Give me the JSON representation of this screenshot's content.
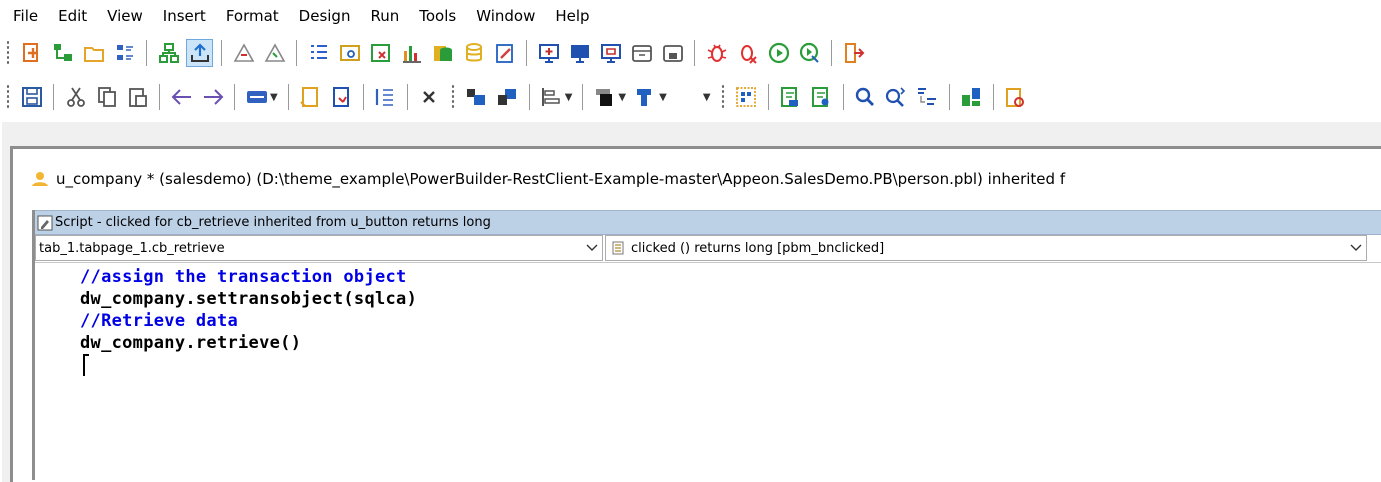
{
  "menu": [
    "File",
    "Edit",
    "View",
    "Insert",
    "Format",
    "Design",
    "Run",
    "Tools",
    "Window",
    "Help"
  ],
  "toolbar1": {
    "buttons": [
      {
        "name": "new-icon",
        "color": "#e07020"
      },
      {
        "name": "inherit-icon",
        "color": "#2a9d3a"
      },
      {
        "name": "open-folder-icon",
        "color": "#e5a52a"
      },
      {
        "name": "library-icon",
        "color": "#3060c0"
      },
      {
        "name": "system-tree-icon",
        "color": "#2a9d3a"
      },
      {
        "name": "output-up-icon",
        "color": "#1f6fd0",
        "active": true
      },
      {
        "name": "build-icon",
        "color": "#888888"
      },
      {
        "name": "deploy-icon",
        "color": "#888888"
      },
      {
        "name": "list-icon",
        "color": "#2a60d0"
      },
      {
        "name": "browser-icon",
        "color": "#d0a020"
      },
      {
        "name": "clip-window-icon",
        "color": "#d03030"
      },
      {
        "name": "chart-icon",
        "color": "#e09020"
      },
      {
        "name": "database-icon",
        "color": "#2a9d3a"
      },
      {
        "name": "db-profile-icon",
        "color": "#e0b020"
      },
      {
        "name": "edit-source-icon",
        "color": "#d04040"
      },
      {
        "name": "run-window-icon",
        "color": "#c03030"
      },
      {
        "name": "monitor-icon",
        "color": "#2050b0"
      },
      {
        "name": "debug-window-icon",
        "color": "#c03030"
      },
      {
        "name": "close-frame-icon",
        "color": "#555555"
      },
      {
        "name": "print-frame-icon",
        "color": "#555555"
      },
      {
        "name": "debug-bug-icon",
        "color": "#e03030"
      },
      {
        "name": "debug-stop-icon",
        "color": "#e03030"
      },
      {
        "name": "run-icon",
        "color": "#2a9d3a"
      },
      {
        "name": "select-run-icon",
        "color": "#2a9d3a"
      },
      {
        "name": "exit-icon",
        "color": "#e08020"
      }
    ]
  },
  "toolbar2": {
    "buttons": [
      {
        "name": "save-icon",
        "color": "#2a5aa0"
      },
      {
        "name": "cut-icon",
        "color": "#555555"
      },
      {
        "name": "copy-icon",
        "color": "#555555"
      },
      {
        "name": "paste-icon",
        "color": "#555555"
      },
      {
        "name": "undo-icon",
        "color": "#6a50b0"
      },
      {
        "name": "redo-icon",
        "color": "#6a50b0"
      },
      {
        "name": "command-icon",
        "color": "#3060c0"
      },
      {
        "name": "comment-icon",
        "color": "#e0a020"
      },
      {
        "name": "uncomment-icon",
        "color": "#2050b0"
      },
      {
        "name": "indent-icon",
        "color": "#3060c0"
      },
      {
        "name": "delete-icon",
        "color": "#333333"
      },
      {
        "name": "bring-front-icon",
        "color": "#2060c0"
      },
      {
        "name": "send-back-icon",
        "color": "#2060c0"
      },
      {
        "name": "align-icon",
        "color": "#555555"
      },
      {
        "name": "text-color-icon",
        "color": "#222222"
      },
      {
        "name": "background-color-icon",
        "color": "#2060c0"
      },
      {
        "name": "grid-icon",
        "color": "#e0a020"
      },
      {
        "name": "tab-order-icon",
        "color": "#2a9d3a"
      },
      {
        "name": "properties-icon",
        "color": "#2a9d3a"
      },
      {
        "name": "find-icon",
        "color": "#2050b0"
      },
      {
        "name": "find-next-icon",
        "color": "#2050b0"
      },
      {
        "name": "replace-icon",
        "color": "#2050b0"
      },
      {
        "name": "pieces-icon",
        "color": "#2a9d3a"
      },
      {
        "name": "clipboard-check-icon",
        "color": "#e0a020"
      }
    ]
  },
  "window": {
    "title": "u_company * (salesdemo) (D:\\theme_example\\PowerBuilder-RestClient-Example-master\\Appeon.SalesDemo.PB\\person.pbl) inherited f",
    "icon_color": "#f2b632"
  },
  "script": {
    "title": "Script - clicked for cb_retrieve inherited from u_button returns long",
    "object_selector": "tab_1.tabpage_1.cb_retrieve",
    "event_selector": "clicked ()  returns long [pbm_bnclicked]",
    "code": [
      {
        "kind": "comment",
        "text": "//assign the transaction object"
      },
      {
        "kind": "statement",
        "text": "dw_company.settransobject(sqlca)"
      },
      {
        "kind": "comment",
        "text": "//Retrieve data"
      },
      {
        "kind": "statement",
        "text": "dw_company.retrieve()"
      }
    ]
  },
  "colors": {
    "comment": "#0000e6",
    "script_title_bar": "#bcd0e6"
  }
}
